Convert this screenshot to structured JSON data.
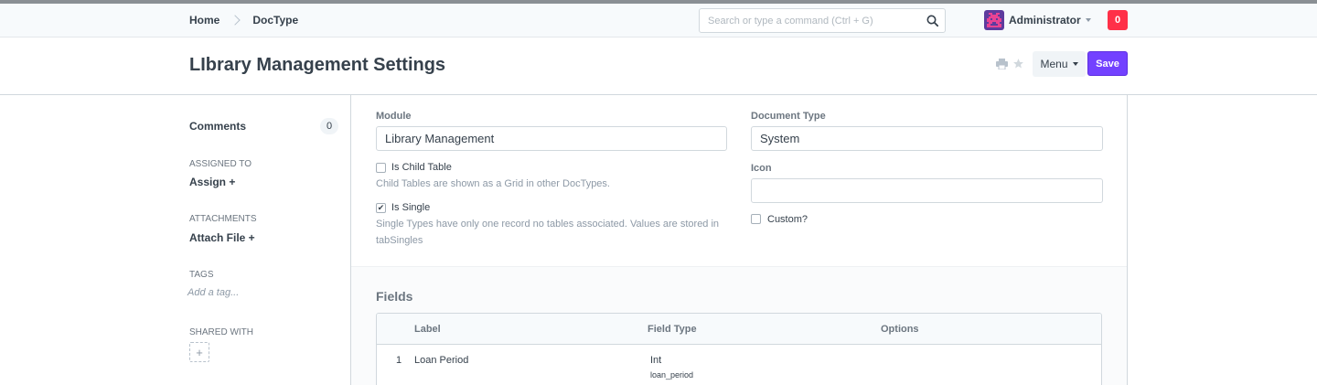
{
  "navbar": {
    "breadcrumbs": [
      "Home",
      "DocType"
    ],
    "search_placeholder": "Search or type a command (Ctrl + G)",
    "user_name": "Administrator",
    "notification_count": "0"
  },
  "page": {
    "title": "LIbrary Management Settings",
    "menu_label": "Menu",
    "save_label": "Save"
  },
  "sidebar": {
    "comments_label": "Comments",
    "comments_count": "0",
    "assigned_to_label": "ASSIGNED TO",
    "assign_label": "Assign +",
    "attachments_label": "ATTACHMENTS",
    "attach_label": "Attach File +",
    "tags_label": "TAGS",
    "add_tag_label": "Add a tag...",
    "shared_with_label": "SHARED WITH",
    "share_add": "+"
  },
  "form": {
    "module_label": "Module",
    "module_value": "Library Management",
    "is_child_table_label": "Is Child Table",
    "is_child_table_checked": false,
    "is_child_table_help": "Child Tables are shown as a Grid in other DocTypes.",
    "is_single_label": "Is Single",
    "is_single_checked": true,
    "is_single_help_line1": "Single Types have only one record no tables associated. Values are stored in",
    "is_single_help_line2": "tabSingles",
    "document_type_label": "Document Type",
    "document_type_value": "System",
    "icon_label": "Icon",
    "icon_value": "",
    "custom_label": "Custom?",
    "custom_checked": false
  },
  "fields": {
    "title": "Fields",
    "columns": [
      "Label",
      "Field Type",
      "Options"
    ],
    "rows": [
      {
        "index": "1",
        "label": "Loan Period",
        "field_type": "Int",
        "field_name": "loan_period",
        "options": ""
      }
    ]
  },
  "colors": {
    "primary": "#7341ff",
    "notification": "#ff3048",
    "text": "#36414c",
    "muted": "#8d99a6"
  }
}
